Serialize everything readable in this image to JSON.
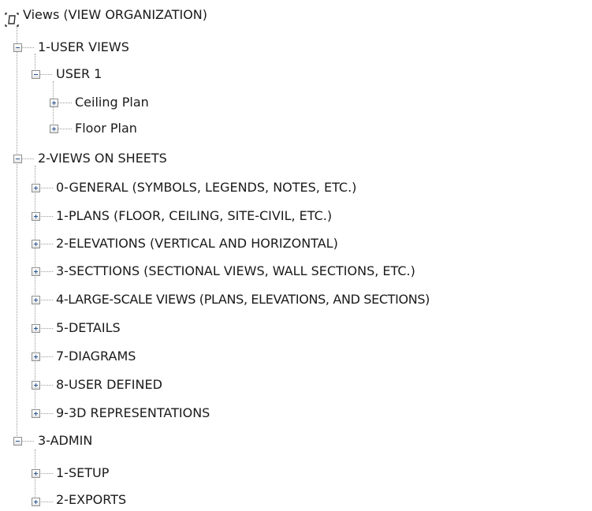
{
  "tree": {
    "root": {
      "label": "Views (VIEW ORGANIZATION)",
      "icon": "views-icon"
    },
    "items": [
      {
        "label": "1-USER VIEWS",
        "expanded": true
      },
      {
        "label": "USER 1",
        "expanded": true
      },
      {
        "label": "Ceiling Plan",
        "expanded": false
      },
      {
        "label": "Floor Plan",
        "expanded": false
      },
      {
        "label": "2-VIEWS ON SHEETS",
        "expanded": true
      },
      {
        "label": "0-GENERAL (SYMBOLS, LEGENDS, NOTES, ETC.)",
        "expanded": false
      },
      {
        "label": "1-PLANS (FLOOR, CEILING, SITE-CIVIL, ETC.)",
        "expanded": false
      },
      {
        "label": "2-ELEVATIONS (VERTICAL AND HORIZONTAL)",
        "expanded": false
      },
      {
        "label": "3-SECTTIONS (SECTIONAL VIEWS, WALL SECTIONS, ETC.)",
        "expanded": false
      },
      {
        "label": "4-LARGE-SCALE VIEWS (PLANS, ELEVATIONS, AND SECTIONS)",
        "expanded": false
      },
      {
        "label": "5-DETAILS",
        "expanded": false
      },
      {
        "label": "7-DIAGRAMS",
        "expanded": false
      },
      {
        "label": "8-USER DEFINED",
        "expanded": false
      },
      {
        "label": "9-3D REPRESENTATIONS",
        "expanded": false
      },
      {
        "label": "3-ADMIN",
        "expanded": true
      },
      {
        "label": "1-SETUP",
        "expanded": false
      },
      {
        "label": "2-EXPORTS",
        "expanded": false
      }
    ]
  },
  "colors": {
    "text": "#1a1a1a",
    "guide_line": "#9a9a9a",
    "toggle_border": "#8e8f8f",
    "toggle_glyph": "#2b5797",
    "root_icon": "#2f2f2f"
  }
}
